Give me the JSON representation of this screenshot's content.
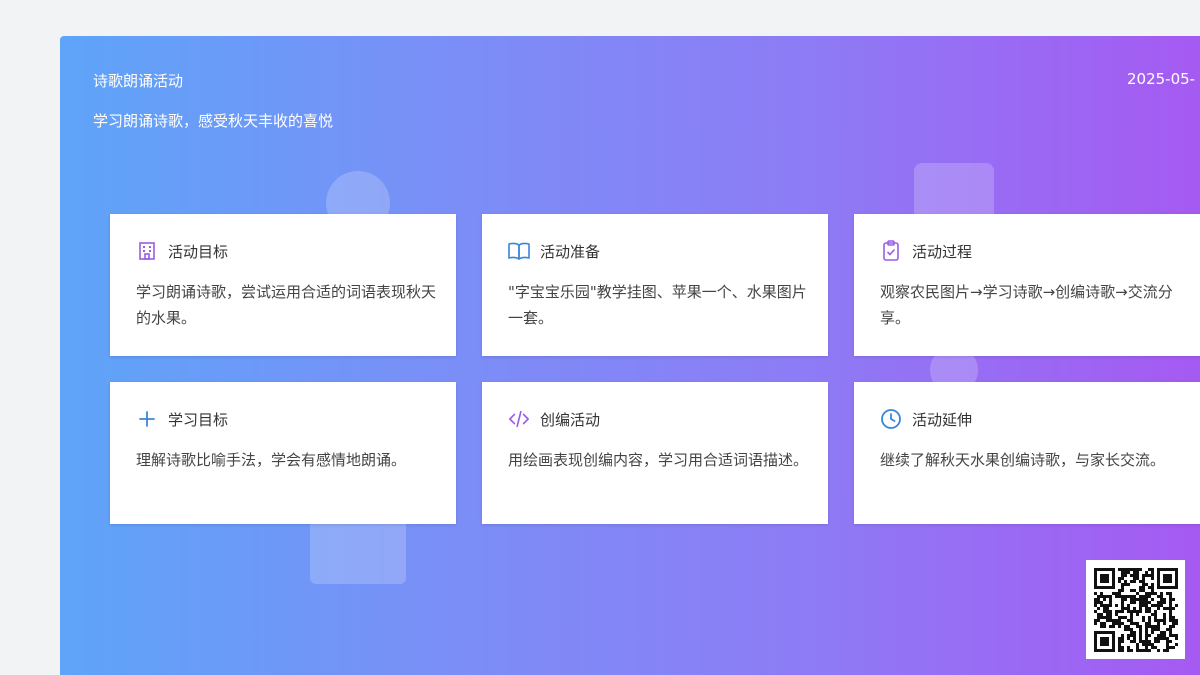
{
  "header": {
    "title": "诗歌朗诵活动",
    "subtitle": "学习朗诵诗歌，感受秋天丰收的喜悦",
    "date": "2025-05-"
  },
  "cards": [
    {
      "icon": "building-icon",
      "title": "活动目标",
      "body": "学习朗诵诗歌，尝试运用合适的词语表现秋天的水果。"
    },
    {
      "icon": "book-icon",
      "title": "活动准备",
      "body": "\"字宝宝乐园\"教学挂图、苹果一个、水果图片一套。"
    },
    {
      "icon": "clipboard-check-icon",
      "title": "活动过程",
      "body": "观察农民图片→学习诗歌→创编诗歌→交流分享。"
    },
    {
      "icon": "plus-icon",
      "title": "学习目标",
      "body": "理解诗歌比喻手法，学会有感情地朗诵。"
    },
    {
      "icon": "code-icon",
      "title": "创编活动",
      "body": "用绘画表现创编内容，学习用合适词语描述。"
    },
    {
      "icon": "clock-icon",
      "title": "活动延伸",
      "body": "继续了解秋天水果创编诗歌，与家长交流。"
    }
  ],
  "colors": {
    "gradient_start": "#5ea4f8",
    "gradient_end": "#a55af2",
    "icon_purple": "#9b5de5",
    "icon_blue": "#3a86d8"
  }
}
